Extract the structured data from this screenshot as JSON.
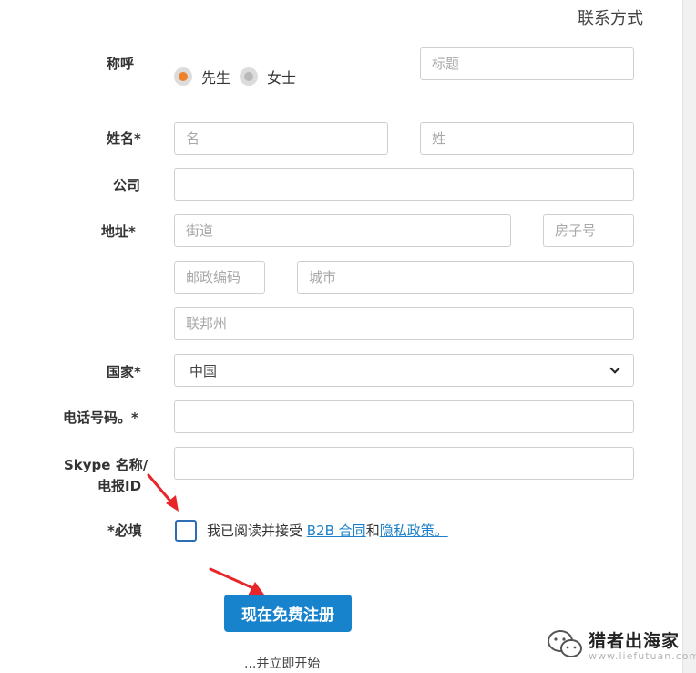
{
  "section_title": "联系方式",
  "salutation": {
    "label": "称呼",
    "options": [
      "先生",
      "女士"
    ],
    "selected": "先生",
    "title_placeholder": "标题"
  },
  "name": {
    "label": "姓名*",
    "first_placeholder": "名",
    "last_placeholder": "姓"
  },
  "company": {
    "label": "公司",
    "placeholder": ""
  },
  "address": {
    "label": "地址*",
    "street_placeholder": "街道",
    "house_placeholder": "房子号",
    "zip_placeholder": "邮政编码",
    "city_placeholder": "城市",
    "state_placeholder": "联邦州"
  },
  "country": {
    "label": "国家*",
    "selected": "中国"
  },
  "phone": {
    "label": "电话号码。*",
    "placeholder": ""
  },
  "skype": {
    "label_line1": "Skype 名称/",
    "label_line2": "电报ID",
    "placeholder": ""
  },
  "required": {
    "label": "*必填",
    "text_before": "我已阅读并接受 ",
    "link_contract": "B2B 合同",
    "text_between": "和",
    "link_privacy": "隐私政策。"
  },
  "submit_label": "现在免费注册",
  "subtext": "...并立即开始",
  "watermark": {
    "title": "猎者出海家",
    "url": "www.liefutuan.com"
  },
  "colors": {
    "accent": "#1883cd",
    "radio_checked": "#f0812b",
    "arrow": "#e8262a",
    "checkbox_border": "#2c6db3"
  }
}
